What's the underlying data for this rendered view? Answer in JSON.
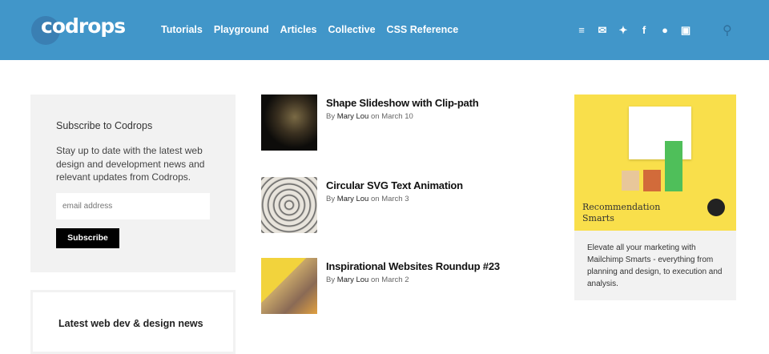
{
  "header": {
    "logo": "codrops",
    "nav": [
      "Tutorials",
      "Playground",
      "Articles",
      "Collective",
      "CSS Reference"
    ]
  },
  "social": [
    {
      "icon": "rss-icon",
      "glyph": "≡"
    },
    {
      "icon": "mail-icon",
      "glyph": "✉"
    },
    {
      "icon": "twitter-icon",
      "glyph": "✦"
    },
    {
      "icon": "facebook-icon",
      "glyph": "f"
    },
    {
      "icon": "github-icon",
      "glyph": "●"
    },
    {
      "icon": "instagram-icon",
      "glyph": "▣"
    }
  ],
  "subscribe": {
    "title": "Subscribe to Codrops",
    "text": "Stay up to date with the latest web design and development news and relevant updates from Codrops.",
    "placeholder": "email address",
    "button": "Subscribe"
  },
  "news": {
    "title": "Latest web dev & design news"
  },
  "articles": [
    {
      "title": "Shape Slideshow with Clip-path",
      "by": "By",
      "author": "Mary Lou",
      "on": "on March 10"
    },
    {
      "title": "Circular SVG Text Animation",
      "by": "By",
      "author": "Mary Lou",
      "on": "on March 3"
    },
    {
      "title": "Inspirational Websites Roundup #23",
      "by": "By",
      "author": "Mary Lou",
      "on": "on March 2"
    }
  ],
  "ad": {
    "headline": "Recommendation Smarts",
    "brand": "mailchimp",
    "text": "Elevate all your marketing with Mailchimp Smarts - everything from planning and design, to execution and analysis."
  },
  "colors": {
    "header": "#4196c9",
    "ad": "#f9df4b"
  }
}
